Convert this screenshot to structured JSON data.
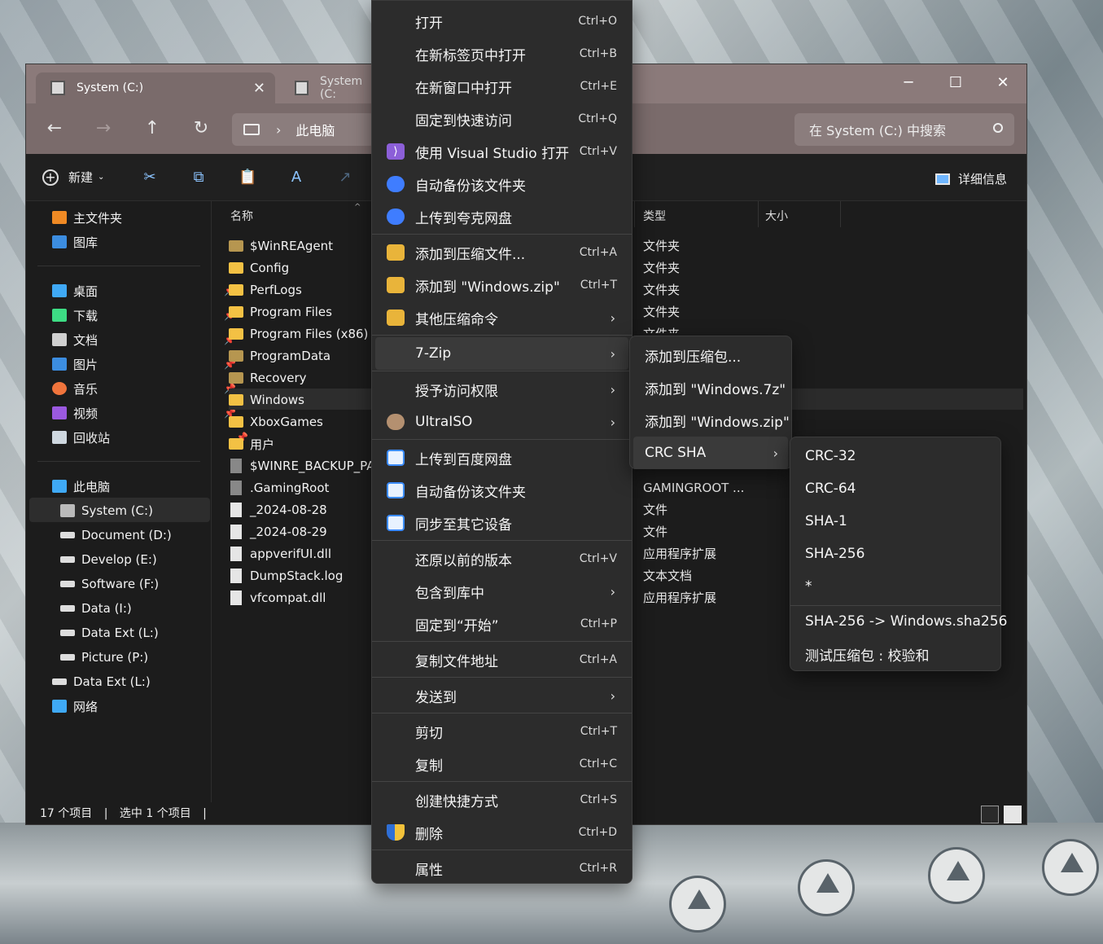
{
  "explorer": {
    "tabs": [
      {
        "label": "System (C:)"
      },
      {
        "label": "System (C:"
      }
    ],
    "address": {
      "crumb": "此电脑"
    },
    "search": {
      "placeholder": "在 System (C:) 中搜索"
    },
    "toolbar": {
      "new_label": "新建",
      "details_label": "详细信息"
    },
    "sidebar": {
      "quick": [
        {
          "label": "主文件夹",
          "color": "#f08a24"
        },
        {
          "label": "图库",
          "color": "#3c8de0"
        }
      ],
      "pinned": [
        {
          "label": "桌面",
          "color": "#3fa9f5"
        },
        {
          "label": "下载",
          "color": "#3ddc84"
        },
        {
          "label": "文档",
          "color": "#d0d0d0"
        },
        {
          "label": "图片",
          "color": "#3c8de0"
        },
        {
          "label": "音乐",
          "color": "#f0743c"
        },
        {
          "label": "视频",
          "color": "#9b59e0"
        },
        {
          "label": "回收站",
          "color": "#cfd8e0"
        }
      ],
      "pc_label": "此电脑",
      "drives": [
        {
          "label": "System (C:)"
        },
        {
          "label": "Document (D:)"
        },
        {
          "label": "Develop (E:)"
        },
        {
          "label": "Software (F:)"
        },
        {
          "label": "Data (I:)"
        },
        {
          "label": "Data Ext (L:)"
        },
        {
          "label": "Picture (P:)"
        }
      ],
      "extra": [
        {
          "label": "Data Ext (L:)"
        },
        {
          "label": "网络"
        }
      ]
    },
    "columns": {
      "name": "名称",
      "type": "类型",
      "size": "大小"
    },
    "files": [
      {
        "name": "$WinREAgent",
        "kind": "folder-dim"
      },
      {
        "name": "Config",
        "kind": "folder"
      },
      {
        "name": "PerfLogs",
        "kind": "folder"
      },
      {
        "name": "Program Files",
        "kind": "folder"
      },
      {
        "name": "Program Files (x86)",
        "kind": "folder"
      },
      {
        "name": "ProgramData",
        "kind": "folder-dim"
      },
      {
        "name": "Recovery",
        "kind": "folder-dim"
      },
      {
        "name": "Windows",
        "kind": "folder"
      },
      {
        "name": "XboxGames",
        "kind": "folder"
      },
      {
        "name": "用户",
        "kind": "folder"
      },
      {
        "name": "$WINRE_BACKUP_PA",
        "kind": "file"
      },
      {
        "name": ".GamingRoot",
        "kind": "file"
      },
      {
        "name": "_2024-08-28",
        "kind": "file"
      },
      {
        "name": "_2024-08-29",
        "kind": "file"
      },
      {
        "name": "appverifUI.dll",
        "kind": "file"
      },
      {
        "name": "DumpStack.log",
        "kind": "file"
      },
      {
        "name": "vfcompat.dll",
        "kind": "file"
      }
    ],
    "types_top": [
      "文件夹",
      "文件夹",
      "文件夹",
      "文件夹",
      "文件夹"
    ],
    "types_bottom": [
      "GAMINGROOT ...",
      "文件",
      "文件",
      "应用程序扩展",
      "文本文档",
      "应用程序扩展"
    ],
    "status": {
      "count": "17 个项目",
      "selected": "选中 1 个项目"
    }
  },
  "context_menu": {
    "items": [
      {
        "label": "打开",
        "key": "Ctrl+O",
        "icon": ""
      },
      {
        "label": "在新标签页中打开",
        "key": "Ctrl+B",
        "icon": ""
      },
      {
        "label": "在新窗口中打开",
        "key": "Ctrl+E",
        "icon": ""
      },
      {
        "label": "固定到快速访问",
        "key": "Ctrl+Q",
        "icon": ""
      },
      {
        "label": "使用 Visual Studio 打开",
        "key": "Ctrl+V",
        "icon": "vs-icon"
      },
      {
        "label": "自动备份该文件夹",
        "key": "",
        "icon": "cloud-icon"
      },
      {
        "label": "上传到夸克网盘",
        "key": "",
        "icon": "cloud-icon"
      },
      {
        "label": "添加到压缩文件...",
        "key": "Ctrl+A",
        "icon": "archive-icon"
      },
      {
        "label": "添加到 \"Windows.zip\"",
        "key": "Ctrl+T",
        "icon": "archive-icon"
      },
      {
        "label": "其他压缩命令",
        "key": "",
        "icon": "archive-icon",
        "submenu": true
      },
      {
        "label": "7-Zip",
        "key": "",
        "icon": "",
        "submenu": true
      },
      {
        "label": "授予访问权限",
        "key": "",
        "icon": "",
        "submenu": true
      },
      {
        "label": "UltraISO",
        "key": "",
        "icon": "disc-icon",
        "submenu": true
      },
      {
        "label": "上传到百度网盘",
        "key": "",
        "icon": "baidu-icon"
      },
      {
        "label": "自动备份该文件夹",
        "key": "",
        "icon": "baidu-icon"
      },
      {
        "label": "同步至其它设备",
        "key": "",
        "icon": "baidu-icon"
      },
      {
        "label": "还原以前的版本",
        "key": "Ctrl+V",
        "icon": ""
      },
      {
        "label": "包含到库中",
        "key": "",
        "icon": "",
        "submenu": true
      },
      {
        "label": "固定到“开始”",
        "key": "Ctrl+P",
        "icon": ""
      },
      {
        "label": "复制文件地址",
        "key": "Ctrl+A",
        "icon": ""
      },
      {
        "label": "发送到",
        "key": "",
        "icon": "",
        "submenu": true
      },
      {
        "label": "剪切",
        "key": "Ctrl+T",
        "icon": ""
      },
      {
        "label": "复制",
        "key": "Ctrl+C",
        "icon": ""
      },
      {
        "label": "创建快捷方式",
        "key": "Ctrl+S",
        "icon": ""
      },
      {
        "label": "删除",
        "key": "Ctrl+D",
        "icon": "shield-icon"
      },
      {
        "label": "属性",
        "key": "Ctrl+R",
        "icon": ""
      }
    ]
  },
  "sevenzip_menu": {
    "items": [
      "添加到压缩包...",
      "添加到 \"Windows.7z\"",
      "添加到 \"Windows.zip\"",
      "CRC SHA"
    ]
  },
  "crc_menu": {
    "items": [
      "CRC-32",
      "CRC-64",
      "SHA-1",
      "SHA-256",
      "*",
      "SHA-256 -> Windows.sha256",
      "测试压缩包 : 校验和"
    ]
  }
}
